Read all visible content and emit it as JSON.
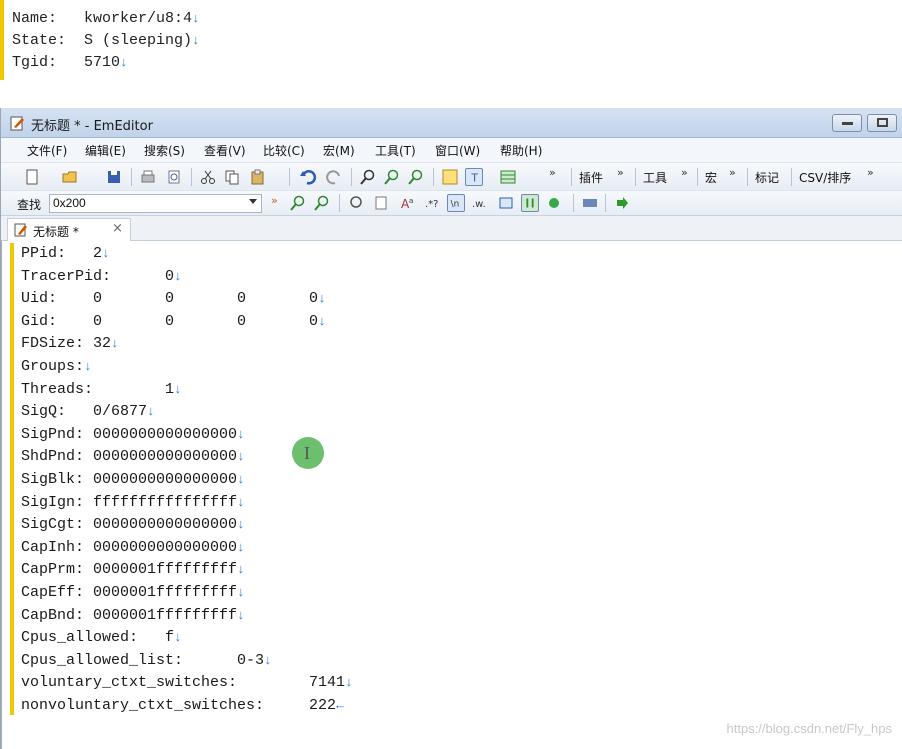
{
  "top_snippet": {
    "lines": [
      {
        "text": "Name:   kworker/u8:4",
        "eol": "↓"
      },
      {
        "text": "State:  S (sleeping)",
        "eol": "↓"
      },
      {
        "text": "Tgid:   5710",
        "eol": "↓"
      }
    ]
  },
  "window": {
    "title": "无标题 * - EmEditor",
    "menu": [
      "文件(F)",
      "编辑(E)",
      "搜索(S)",
      "查看(V)",
      "比较(C)",
      "宏(M)",
      "工具(T)",
      "窗口(W)",
      "帮助(H)"
    ],
    "toolbar_labels": {
      "plugins": "插件",
      "tools": "工具",
      "macro": "宏",
      "mark": "标记",
      "csv_sort": "CSV/排序",
      "more": "»"
    },
    "find": {
      "label": "查找",
      "value": "0x200"
    },
    "tab": {
      "label": "无标题 *",
      "close": "×"
    }
  },
  "editor": {
    "lines": [
      {
        "text": "PPid:   2",
        "eol": "↓"
      },
      {
        "text": "TracerPid:      0",
        "eol": "↓"
      },
      {
        "text": "Uid:    0       0       0       0",
        "eol": "↓"
      },
      {
        "text": "Gid:    0       0       0       0",
        "eol": "↓"
      },
      {
        "text": "FDSize: 32",
        "eol": "↓"
      },
      {
        "text": "Groups:",
        "eol": "↓"
      },
      {
        "text": "Threads:        1",
        "eol": "↓"
      },
      {
        "text": "SigQ:   0/6877",
        "eol": "↓"
      },
      {
        "text": "SigPnd: 0000000000000000",
        "eol": "↓"
      },
      {
        "text": "ShdPnd: 0000000000000000",
        "eol": "↓"
      },
      {
        "text": "SigBlk: 0000000000000000",
        "eol": "↓"
      },
      {
        "text": "SigIgn: ffffffffffffffff",
        "eol": "↓"
      },
      {
        "text": "SigCgt: 0000000000000000",
        "eol": "↓"
      },
      {
        "text": "CapInh: 0000000000000000",
        "eol": "↓"
      },
      {
        "text": "CapPrm: 0000001fffffffff",
        "eol": "↓"
      },
      {
        "text": "CapEff: 0000001fffffffff",
        "eol": "↓"
      },
      {
        "text": "CapBnd: 0000001fffffffff",
        "eol": "↓"
      },
      {
        "text": "Cpus_allowed:   f",
        "eol": "↓"
      },
      {
        "text": "Cpus_allowed_list:      0-3",
        "eol": "↓"
      },
      {
        "text": "voluntary_ctxt_switches:        7141",
        "eol": "↓"
      },
      {
        "text": "nonvoluntary_ctxt_switches:     222",
        "eol": "←"
      }
    ]
  },
  "watermark": "https://blog.csdn.net/Fly_hps",
  "colors": {
    "eol_marker": "#2e7fd6",
    "gutter_marker": "#f0c800",
    "cursor_circle": "#5cb85c"
  }
}
